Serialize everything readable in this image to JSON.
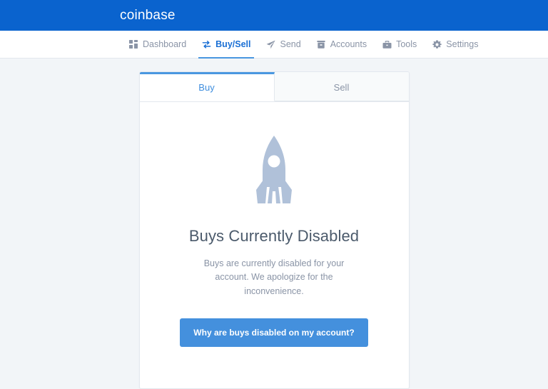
{
  "header": {
    "logo_text": "coinbase",
    "background_color": "#0a63ce"
  },
  "nav": {
    "items": [
      {
        "label": "Dashboard",
        "icon": "grid-icon",
        "active": false
      },
      {
        "label": "Buy/Sell",
        "icon": "exchange-icon",
        "active": true
      },
      {
        "label": "Send",
        "icon": "paper-plane-icon",
        "active": false
      },
      {
        "label": "Accounts",
        "icon": "wallet-icon",
        "active": false
      },
      {
        "label": "Tools",
        "icon": "briefcase-icon",
        "active": false
      },
      {
        "label": "Settings",
        "icon": "gear-icon",
        "active": false
      }
    ],
    "active_color": "#1a6fd4",
    "inactive_color": "#8a94a6"
  },
  "card": {
    "tabs": [
      {
        "label": "Buy",
        "active": true
      },
      {
        "label": "Sell",
        "active": false
      }
    ],
    "illustration": "rocket-icon",
    "illustration_color": "#b0c1d9",
    "title": "Buys Currently Disabled",
    "description": "Buys are currently disabled for your account. We apologize for the inconvenience.",
    "cta_label": "Why are buys disabled on my account?",
    "cta_color": "#4490dd"
  },
  "page": {
    "background_color": "#f2f5f8"
  }
}
